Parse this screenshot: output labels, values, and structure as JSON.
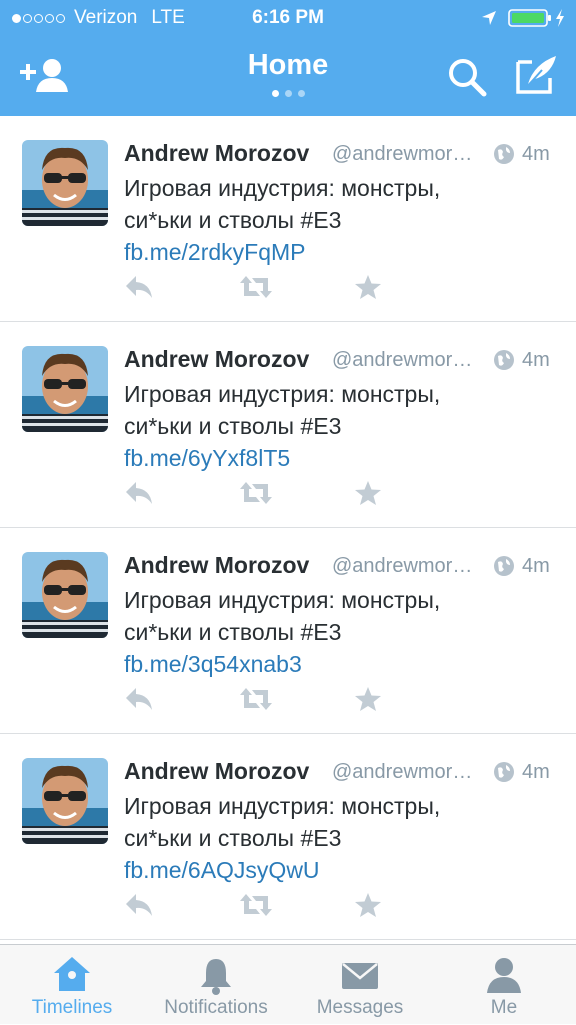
{
  "colors": {
    "accent": "#55acee",
    "link": "#2b7bb9",
    "muted": "#8899a6",
    "text": "#292f33",
    "battery": "#4cd964"
  },
  "status_bar": {
    "carrier": "Verizon",
    "network": "LTE",
    "time": "6:16 PM",
    "signal_bars_filled": 1,
    "signal_bars_total": 5
  },
  "nav": {
    "title": "Home",
    "page_count": 3,
    "current_page": 1,
    "icons": [
      "add-user-icon",
      "search-icon",
      "compose-icon"
    ]
  },
  "tweets": [
    {
      "name": "Andrew Morozov",
      "handle": "@andrewmor…",
      "time": "4m",
      "text": "Игровая индустрия: монстры, си*ьки и стволы #E3 ",
      "link": "fb.me/2rdkyFqMP"
    },
    {
      "name": "Andrew Morozov",
      "handle": "@andrewmor…",
      "time": "4m",
      "text": "Игровая индустрия: монстры, си*ьки и стволы #E3 ",
      "link": "fb.me/6yYxf8lT5"
    },
    {
      "name": "Andrew Morozov",
      "handle": "@andrewmor…",
      "time": "4m",
      "text": "Игровая индустрия: монстры, си*ьки и стволы #E3 ",
      "link": "fb.me/3q54xnab3"
    },
    {
      "name": "Andrew Morozov",
      "handle": "@andrewmor…",
      "time": "4m",
      "text": "Игровая индустрия: монстры, си*ьки и стволы #E3 ",
      "link": "fb.me/6AQJsyQwU"
    }
  ],
  "tweet_actions": [
    "reply-icon",
    "retweet-icon",
    "favorite-icon"
  ],
  "tabs": [
    {
      "label": "Timelines",
      "icon": "home-icon",
      "active": true
    },
    {
      "label": "Notifications",
      "icon": "bell-icon",
      "active": false
    },
    {
      "label": "Messages",
      "icon": "envelope-icon",
      "active": false
    },
    {
      "label": "Me",
      "icon": "person-icon",
      "active": false
    }
  ]
}
